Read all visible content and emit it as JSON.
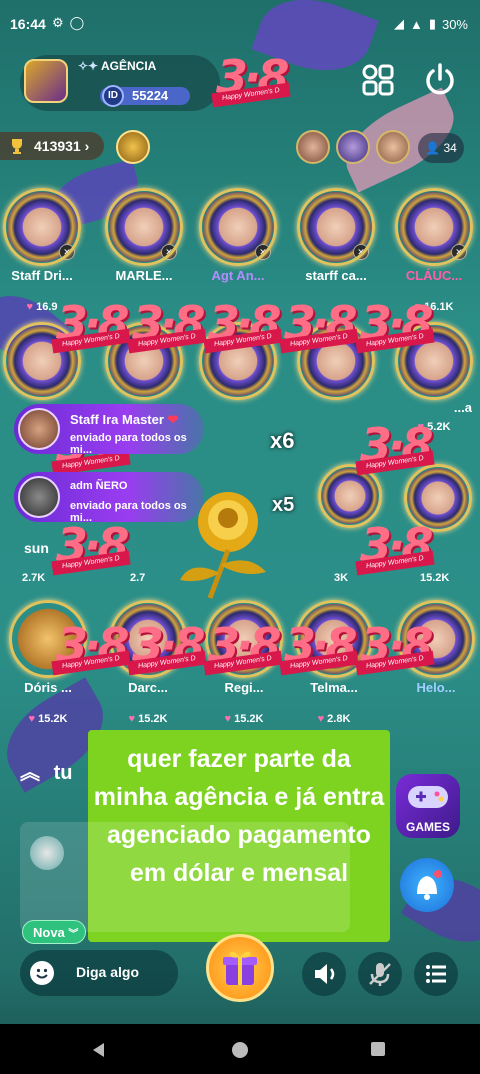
{
  "status_bar": {
    "time": "16:44",
    "battery": "30%"
  },
  "room": {
    "name": "AGÊNCIA",
    "id_badge": "ID",
    "id": "55224"
  },
  "coins": "413931",
  "online_count": "34",
  "seats_row1": [
    {
      "name": "Staff Dri...",
      "score": "16.9"
    },
    {
      "name": "MARLE...",
      "score": ""
    },
    {
      "name": "Agt An...",
      "score": ""
    },
    {
      "name": "starff ca...",
      "score": ""
    },
    {
      "name": "CLÁUC...",
      "score": "16.1K"
    }
  ],
  "seats_row2": [
    {
      "name": "",
      "score": ""
    },
    {
      "name": "",
      "score": ""
    },
    {
      "name": "",
      "score": ""
    },
    {
      "name": "",
      "score": ""
    },
    {
      "name": "...a",
      "score": "5.2K"
    }
  ],
  "seats_row3": [
    {
      "name": "sun",
      "score": "2.7K"
    },
    {
      "name": "",
      "score": "2.7"
    },
    {
      "name": "",
      "score": ""
    },
    {
      "name": "",
      "score": "3K"
    },
    {
      "name": "",
      "score": "15.2K"
    }
  ],
  "seats_row4": [
    {
      "name": "Dóris ...",
      "score": "15.2K"
    },
    {
      "name": "Darc...",
      "score": "15.2K"
    },
    {
      "name": "Regi...",
      "score": "15.2K"
    },
    {
      "name": "Telma...",
      "score": "2.8K"
    },
    {
      "name": "Helo...",
      "score": ""
    }
  ],
  "banner_text": {
    "num": "3·8",
    "ribbon": "Happy Women's D"
  },
  "notifications": [
    {
      "name": "Staff Ira Master",
      "msg": "enviado para todos os mi...",
      "count": "x6"
    },
    {
      "name": "adm ÑERO",
      "msg": "enviado para todos os mi...",
      "count": "x5"
    }
  ],
  "promo_text": "quer fazer parte da minha agência e já entra agenciado pagamento em dólar e mensal",
  "tab_label": "tu",
  "games_label": "GAMES",
  "nova_label": "Nova",
  "say_placeholder": "Diga algo",
  "colors": {
    "accent": "#7ed321",
    "banner": "#ff6d86",
    "ribbon": "#d8174a",
    "notif": "#6b2bd6"
  }
}
